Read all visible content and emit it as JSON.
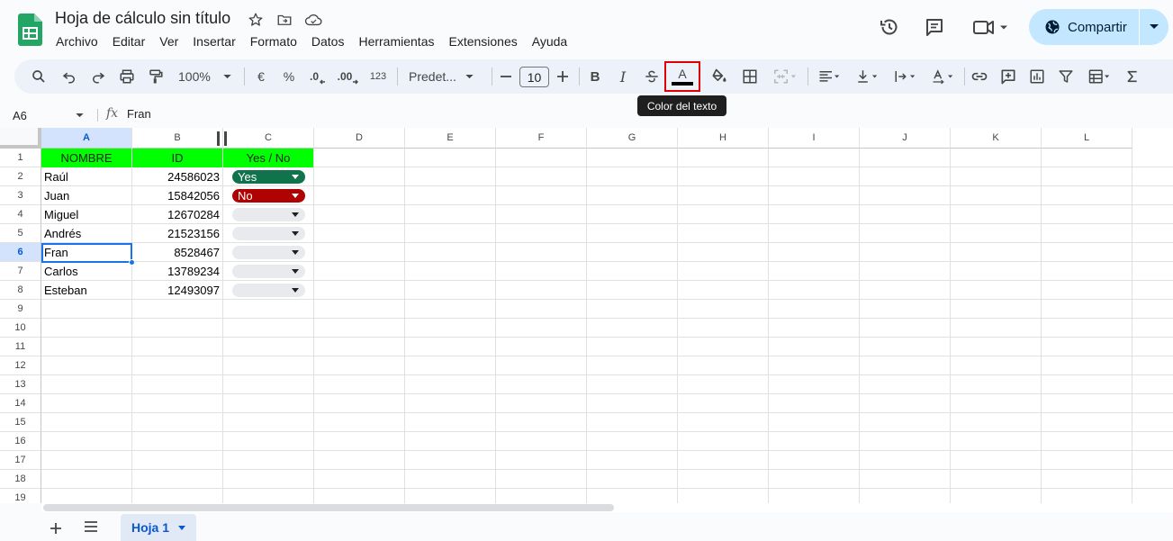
{
  "app": {
    "title": "Hoja de cálculo sin título"
  },
  "menu": [
    "Archivo",
    "Editar",
    "Ver",
    "Insertar",
    "Formato",
    "Datos",
    "Herramientas",
    "Extensiones",
    "Ayuda"
  ],
  "share": {
    "label": "Compartir"
  },
  "toolbar": {
    "zoom": "100%",
    "currency": "€",
    "percent": "%",
    "decrease_decimals": ".0",
    "increase_decimals": ".00",
    "number_format": "123",
    "font": "Predet...",
    "font_size": "10",
    "decrease_font": "—",
    "increase_font": "+",
    "bold": "B",
    "italic": "I",
    "text_color": "A",
    "text_color_swatch": "#000000",
    "highlight_color": "#e00000",
    "tooltip": "Color del texto"
  },
  "formula_bar": {
    "cell_ref": "A6",
    "fx": "fx",
    "value": "Fran"
  },
  "columns": [
    "A",
    "B",
    "C",
    "D",
    "E",
    "F",
    "G",
    "H",
    "I",
    "J",
    "K",
    "L"
  ],
  "rows": [
    "1",
    "2",
    "3",
    "4",
    "5",
    "6",
    "7",
    "8",
    "9",
    "10",
    "11",
    "12",
    "13",
    "14",
    "15",
    "16",
    "17",
    "18",
    "19"
  ],
  "sheet": {
    "header": [
      "NOMBRE",
      "ID",
      "Yes / No"
    ],
    "header_color": "#00ff00",
    "data": [
      {
        "nombre": "Raúl",
        "id": "24586023",
        "status": "Yes"
      },
      {
        "nombre": "Juan",
        "id": "15842056",
        "status": "No"
      },
      {
        "nombre": "Miguel",
        "id": "12670284",
        "status": ""
      },
      {
        "nombre": "Andrés",
        "id": "21523156",
        "status": ""
      },
      {
        "nombre": "Fran",
        "id": "8528467",
        "status": ""
      },
      {
        "nombre": "Carlos",
        "id": "13789234",
        "status": ""
      },
      {
        "nombre": "Esteban",
        "id": "12493097",
        "status": ""
      }
    ],
    "status_colors": {
      "Yes": "#11734b",
      "No": "#b10202"
    }
  },
  "selected_cell": "A6",
  "tabs": [
    {
      "label": "Hoja 1",
      "active": true
    }
  ]
}
